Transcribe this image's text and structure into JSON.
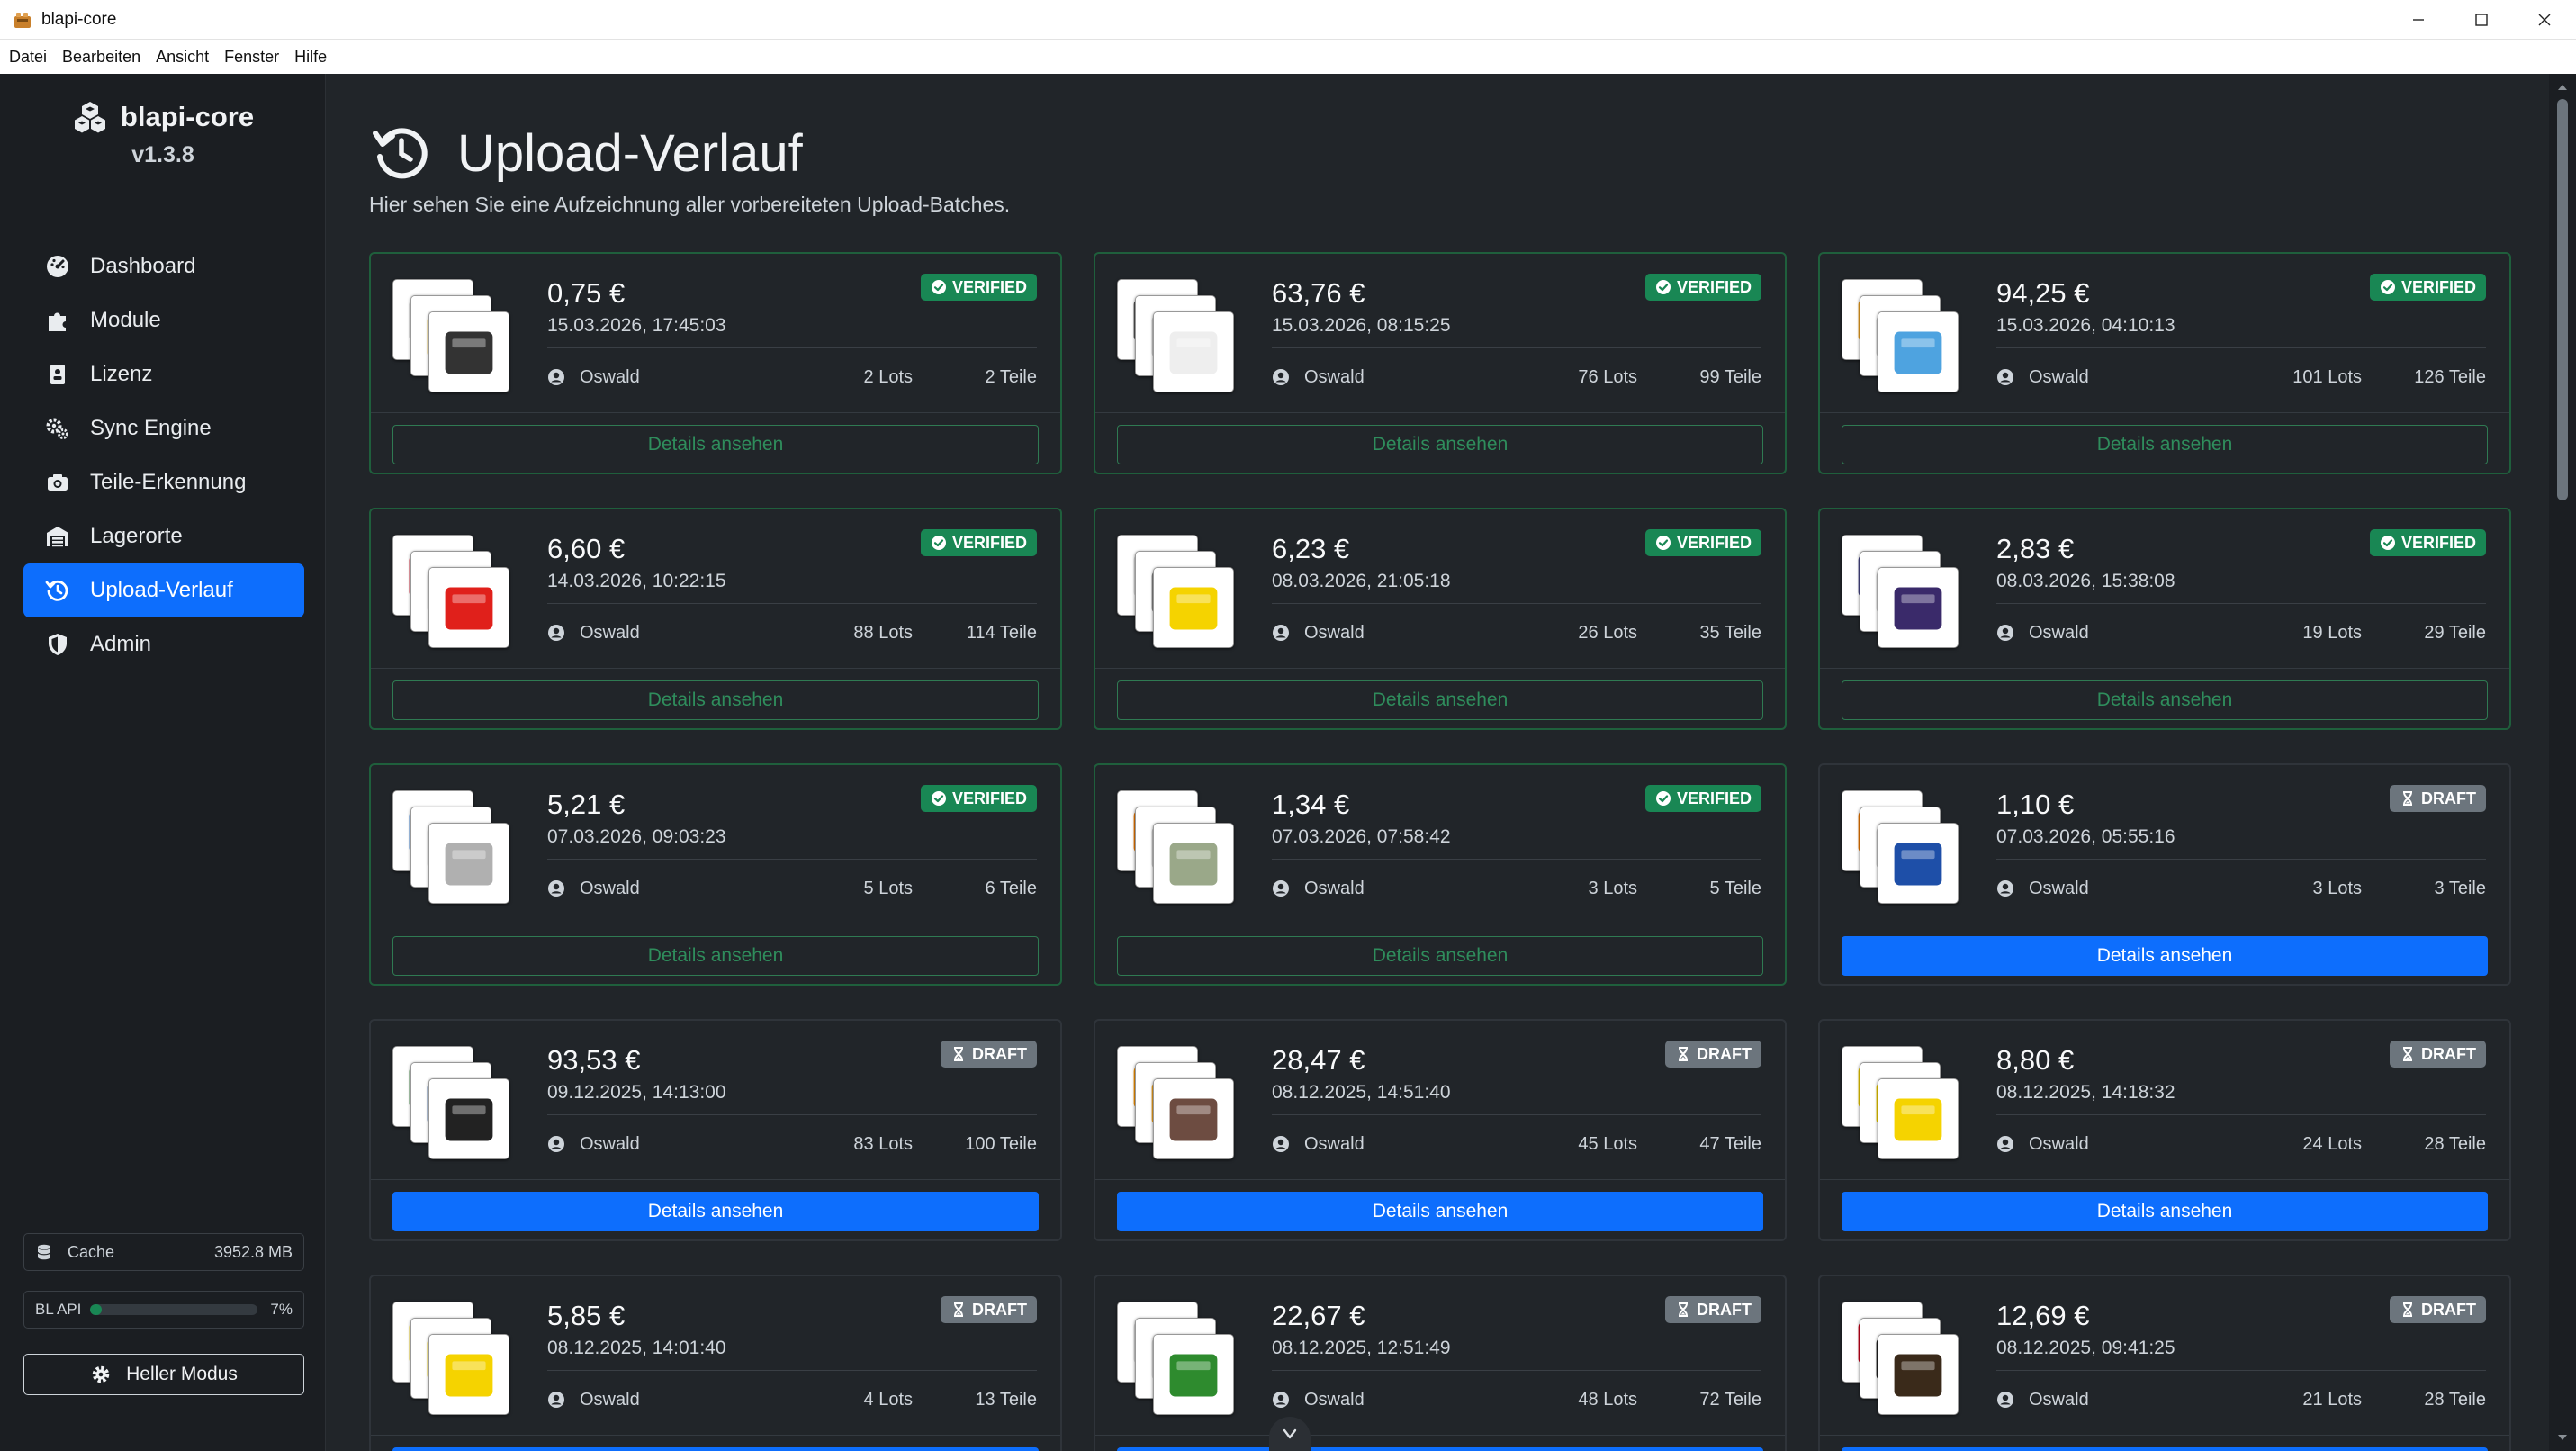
{
  "window": {
    "title": "blapi-core"
  },
  "menu": [
    "Datei",
    "Bearbeiten",
    "Ansicht",
    "Fenster",
    "Hilfe"
  ],
  "sidebar": {
    "brand": "blapi-core",
    "version": "v1.3.8",
    "items": [
      {
        "label": "Dashboard",
        "icon": "dashboard-icon"
      },
      {
        "label": "Module",
        "icon": "puzzle-icon"
      },
      {
        "label": "Lizenz",
        "icon": "license-icon"
      },
      {
        "label": "Sync Engine",
        "icon": "gears-icon"
      },
      {
        "label": "Teile-Erkennung",
        "icon": "camera-icon"
      },
      {
        "label": "Lagerorte",
        "icon": "warehouse-icon"
      },
      {
        "label": "Upload-Verlauf",
        "icon": "history-icon",
        "active": true
      },
      {
        "label": "Admin",
        "icon": "shield-icon"
      }
    ],
    "cache_label": "Cache",
    "cache_value": "3952.8 MB",
    "api_label": "BL API",
    "api_value": "7%",
    "api_percent": 7,
    "mode_label": "Heller Modus"
  },
  "page": {
    "title": "Upload-Verlauf",
    "subtitle": "Hier sehen Sie eine Aufzeichnung aller vorbereiteten Upload-Batches."
  },
  "details_label": "Details ansehen",
  "colors": {
    "accent": "#0d6efd",
    "verified": "#198754",
    "draft": "#6c757d"
  },
  "batches": [
    {
      "price": "0,75 €",
      "date": "15.03.2026, 17:45:03",
      "status": "VERIFIED",
      "user": "Oswald",
      "lots": "2 Lots",
      "teile": "2 Teile"
    },
    {
      "price": "63,76 €",
      "date": "15.03.2026, 08:15:25",
      "status": "VERIFIED",
      "user": "Oswald",
      "lots": "76 Lots",
      "teile": "99 Teile"
    },
    {
      "price": "94,25 €",
      "date": "15.03.2026, 04:10:13",
      "status": "VERIFIED",
      "user": "Oswald",
      "lots": "101 Lots",
      "teile": "126 Teile"
    },
    {
      "price": "6,60 €",
      "date": "14.03.2026, 10:22:15",
      "status": "VERIFIED",
      "user": "Oswald",
      "lots": "88 Lots",
      "teile": "114 Teile"
    },
    {
      "price": "6,23 €",
      "date": "08.03.2026, 21:05:18",
      "status": "VERIFIED",
      "user": "Oswald",
      "lots": "26 Lots",
      "teile": "35 Teile"
    },
    {
      "price": "2,83 €",
      "date": "08.03.2026, 15:38:08",
      "status": "VERIFIED",
      "user": "Oswald",
      "lots": "19 Lots",
      "teile": "29 Teile"
    },
    {
      "price": "5,21 €",
      "date": "07.03.2026, 09:03:23",
      "status": "VERIFIED",
      "user": "Oswald",
      "lots": "5 Lots",
      "teile": "6 Teile"
    },
    {
      "price": "1,34 €",
      "date": "07.03.2026, 07:58:42",
      "status": "VERIFIED",
      "user": "Oswald",
      "lots": "3 Lots",
      "teile": "5 Teile"
    },
    {
      "price": "1,10 €",
      "date": "07.03.2026, 05:55:16",
      "status": "DRAFT",
      "user": "Oswald",
      "lots": "3 Lots",
      "teile": "3 Teile"
    },
    {
      "price": "93,53 €",
      "date": "09.12.2025, 14:13:00",
      "status": "DRAFT",
      "user": "Oswald",
      "lots": "83 Lots",
      "teile": "100 Teile"
    },
    {
      "price": "28,47 €",
      "date": "08.12.2025, 14:51:40",
      "status": "DRAFT",
      "user": "Oswald",
      "lots": "45 Lots",
      "teile": "47 Teile"
    },
    {
      "price": "8,80 €",
      "date": "08.12.2025, 14:18:32",
      "status": "DRAFT",
      "user": "Oswald",
      "lots": "24 Lots",
      "teile": "28 Teile"
    },
    {
      "price": "5,85 €",
      "date": "08.12.2025, 14:01:40",
      "status": "DRAFT",
      "user": "Oswald",
      "lots": "4 Lots",
      "teile": "13 Teile"
    },
    {
      "price": "22,67 €",
      "date": "08.12.2025, 12:51:49",
      "status": "DRAFT",
      "user": "Oswald",
      "lots": "48 Lots",
      "teile": "72 Teile"
    },
    {
      "price": "12,69 €",
      "date": "08.12.2025, 09:41:25",
      "status": "DRAFT",
      "user": "Oswald",
      "lots": "21 Lots",
      "teile": "28 Teile"
    }
  ]
}
